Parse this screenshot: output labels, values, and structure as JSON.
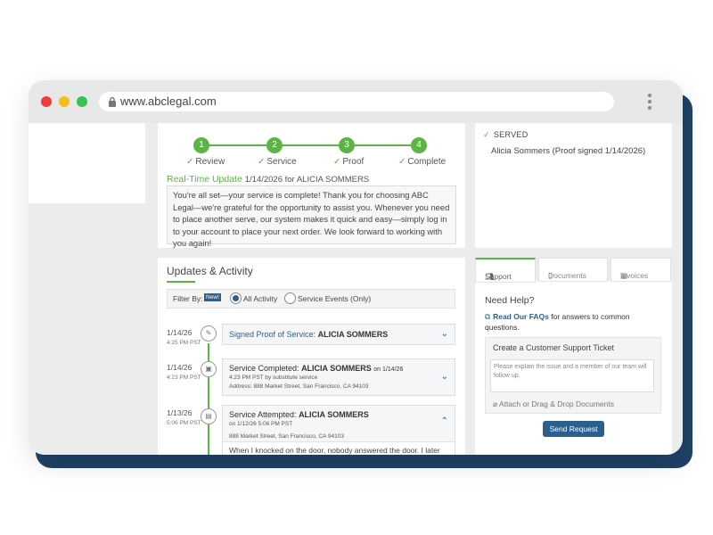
{
  "browser": {
    "url": "www.abclegal.com"
  },
  "status": {
    "steps": [
      {
        "number": "1",
        "label": "Review"
      },
      {
        "number": "2",
        "label": "Service"
      },
      {
        "number": "3",
        "label": "Proof"
      },
      {
        "number": "4",
        "label": "Complete"
      }
    ],
    "realtime_label": "Real-Time Update",
    "realtime_meta": "1/14/2026 for ALICIA SOMMERS",
    "message": "You're all set—your service is complete! Thank you for choosing ABC Legal—we're grateful for the opportunity to assist you. Whenever you need to place another serve, our system makes it quick and easy—simply log in to your account to place your next order. We look forward to working with you again!"
  },
  "served": {
    "heading": "SERVED",
    "detail": "Alicia Sommers (Proof signed 1/14/2026)"
  },
  "updates": {
    "title": "Updates & Activity",
    "filter_label": "Filter By:",
    "new_badge": "New!",
    "option_all": "All Activity",
    "option_service": "Service Events (Only)",
    "events": [
      {
        "date": "1/14/26",
        "time": "4:25 PM PST",
        "title": "Signed Proof of Service:",
        "name": "ALICIA SOMMERS"
      },
      {
        "date": "1/14/26",
        "time": "4:23 PM PST",
        "title": "Service Completed:",
        "name": "ALICIA SOMMERS",
        "on": "on 1/14/26",
        "line2": "4:23 PM PST by substitute service",
        "address": "Address: 888 Market Street, San Francisco, CA 94103"
      },
      {
        "date": "1/13/26",
        "time": "5:06 PM PST",
        "title": "Service Attempted:",
        "name": "ALICIA SOMMERS",
        "line2": "on 1/12/26 5:06 PM PST",
        "address": "888 Market Street, San Francisco, CA 94103",
        "body": "When I knocked on the door, nobody answered the door. I later"
      }
    ]
  },
  "support": {
    "tabs": [
      "Support",
      "Documents",
      "Invoices"
    ],
    "need_help": "Need Help?",
    "faq_link": "Read Our FAQs",
    "faq_rest": "for answers to common questions.",
    "ticket_title": "Create a Customer Support Ticket",
    "ticket_placeholder": "Please explain the issue and a member of our team will follow up.",
    "attach_label": "Attach or Drag & Drop Documents",
    "send_label": "Send Request"
  },
  "colors": {
    "accent_green": "#5bb543",
    "brand_blue": "#2a5f8e",
    "frame_navy": "#1f4266"
  }
}
